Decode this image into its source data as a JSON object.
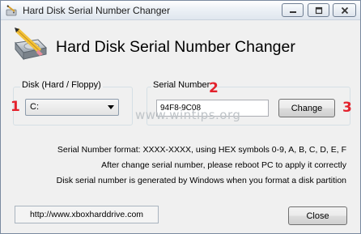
{
  "window": {
    "title": "Hard Disk Serial Number Changer"
  },
  "header": {
    "title": "Hard Disk Serial Number Changer",
    "logo_icon": "disk-pencil-icon"
  },
  "disk_group": {
    "label": "Disk (Hard / Floppy)",
    "selected": "C:"
  },
  "serial_group": {
    "label": "Serial Number",
    "value": "94F8-9C08",
    "change_label": "Change"
  },
  "markers": {
    "one": "1",
    "two": "2",
    "three": "3"
  },
  "watermark": "www.wintips.org",
  "info": {
    "line1": "Serial Number format: XXXX-XXXX, using HEX symbols 0-9, A, B, C, D, E, F",
    "line2": "After change serial number, please reboot PC to apply it correctly",
    "line3": "Disk serial number is generated by Windows when you format a disk partition"
  },
  "footer": {
    "url": "http://www.xboxharddrive.com",
    "close_label": "Close"
  },
  "colors": {
    "marker": "#e3212c",
    "watermark": "#bfc4c8"
  }
}
